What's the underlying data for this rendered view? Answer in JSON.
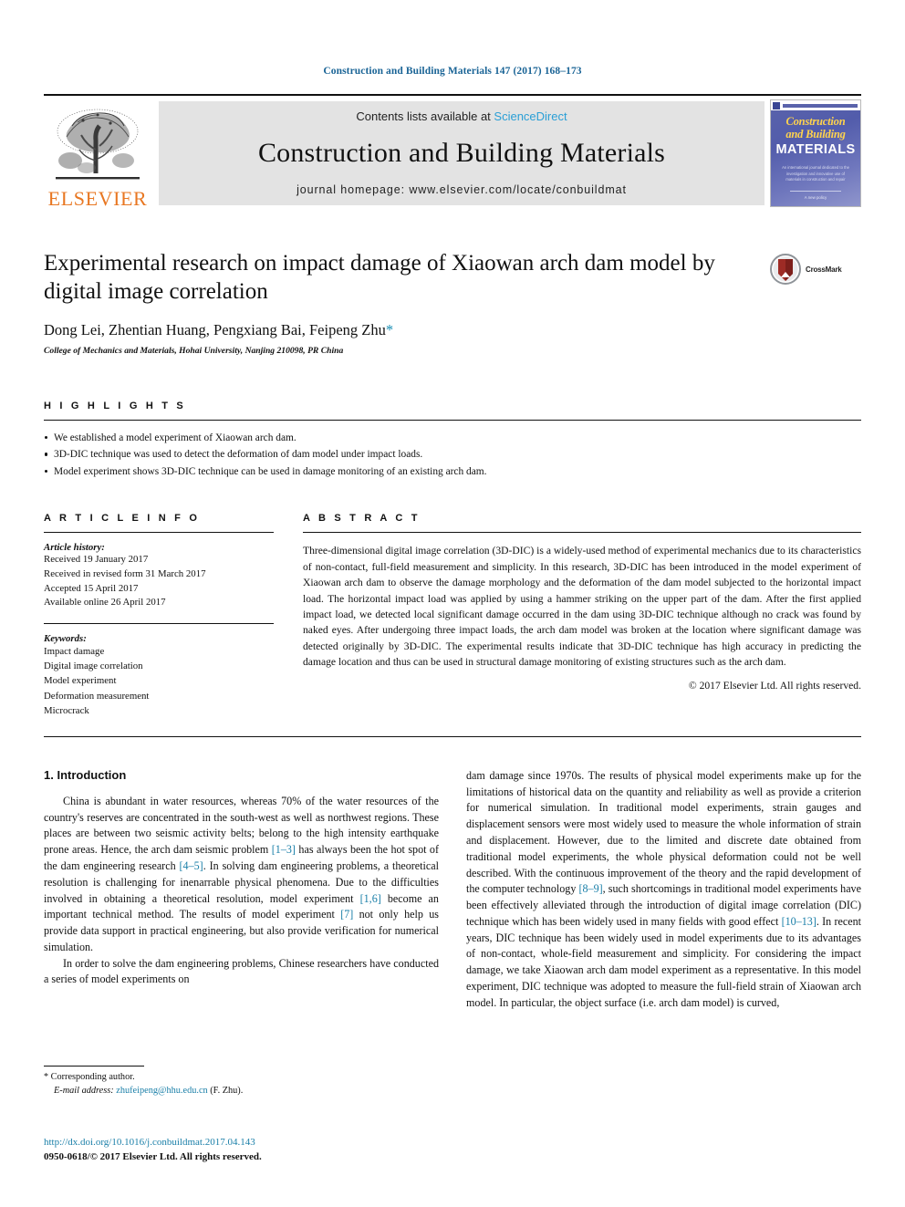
{
  "running_head": "Construction and Building Materials 147 (2017) 168–173",
  "masthead": {
    "publisher_logo_text": "ELSEVIER",
    "contents_prefix": "Contents lists available at ",
    "contents_link": "ScienceDirect",
    "journal_title": "Construction and Building Materials",
    "homepage": "journal homepage: www.elsevier.com/locate/conbuildmat",
    "cover": {
      "line1": "Construction",
      "line2": "and Building",
      "line3": "MATERIALS",
      "subtitle": "An international journal dedicated to the investigation and innovative use of materials in construction and repair",
      "footer": "A new policy"
    }
  },
  "article": {
    "title": "Experimental research on impact damage of Xiaowan arch dam model by digital image correlation",
    "authors": "Dong Lei, Zhentian Huang, Pengxiang Bai, Feipeng Zhu",
    "corresponding_marker": "*",
    "affiliation": "College of Mechanics and Materials, Hohai University, Nanjing 210098, PR China",
    "crossmark_label": "CrossMark"
  },
  "highlights": {
    "heading": "H I G H L I G H T S",
    "items": [
      "We established a model experiment of Xiaowan arch dam.",
      "3D-DIC technique was used to detect the deformation of dam model under impact loads.",
      "Model experiment shows 3D-DIC technique can be used in damage monitoring of an existing arch dam."
    ]
  },
  "article_info": {
    "heading": "A R T I C L E   I N F O",
    "history_label": "Article history:",
    "history": [
      "Received 19 January 2017",
      "Received in revised form 31 March 2017",
      "Accepted 15 April 2017",
      "Available online 26 April 2017"
    ],
    "keywords_label": "Keywords:",
    "keywords": [
      "Impact damage",
      "Digital image correlation",
      "Model experiment",
      "Deformation measurement",
      "Microcrack"
    ]
  },
  "abstract": {
    "heading": "A B S T R A C T",
    "text": "Three-dimensional digital image correlation (3D-DIC) is a widely-used method of experimental mechanics due to its characteristics of non-contact, full-field measurement and simplicity. In this research, 3D-DIC has been introduced in the model experiment of Xiaowan arch dam to observe the damage morphology and the deformation of the dam model subjected to the horizontal impact load. The horizontal impact load was applied by using a hammer striking on the upper part of the dam. After the first applied impact load, we detected local significant damage occurred in the dam using 3D-DIC technique although no crack was found by naked eyes. After undergoing three impact loads, the arch dam model was broken at the location where significant damage was detected originally by 3D-DIC. The experimental results indicate that 3D-DIC technique has high accuracy in predicting the damage location and thus can be used in structural damage monitoring of existing structures such as the arch dam.",
    "copyright": "© 2017 Elsevier Ltd. All rights reserved."
  },
  "introduction": {
    "section_title": "1. Introduction",
    "left_para1_a": "China is abundant in water resources, whereas 70% of the water resources of the country's reserves are concentrated in the south-west as well as northwest regions. These places are between two seismic activity belts; belong to the high intensity earthquake prone areas. Hence, the arch dam seismic problem ",
    "left_cite1": "[1–3]",
    "left_para1_b": " has always been the hot spot of the dam engineering research ",
    "left_cite2": "[4–5]",
    "left_para1_c": ". In solving dam engineering problems, a theoretical resolution is challenging for inenarrable physical phenomena. Due to the difficulties involved in obtaining a theoretical resolution, model experiment ",
    "left_cite3": "[1,6]",
    "left_para1_d": " become an important technical method. The results of model experiment ",
    "left_cite4": "[7]",
    "left_para1_e": " not only help us provide data support in practical engineering, but also provide verification for numerical simulation.",
    "left_para2": "In order to solve the dam engineering problems, Chinese researchers have conducted a series of model experiments on",
    "right_para_a": "dam damage since 1970s. The results of physical model experiments make up for the limitations of historical data on the quantity and reliability as well as provide a criterion for numerical simulation. In traditional model experiments, strain gauges and displacement sensors were most widely used to measure the whole information of strain and displacement. However, due to the limited and discrete date obtained from traditional model experiments, the whole physical deformation could not be well described. With the continuous improvement of the theory and the rapid development of the computer technology ",
    "right_cite1": "[8–9]",
    "right_para_b": ", such shortcomings in traditional model experiments have been effectively alleviated through the introduction of digital image correlation (DIC) technique which has been widely used in many fields with good effect ",
    "right_cite2": "[10–13]",
    "right_para_c": ". In recent years, DIC technique has been widely used in model experiments due to its advantages of non-contact, whole-field measurement and simplicity. For considering the impact damage, we take Xiaowan arch dam model experiment as a representative. In this model experiment, DIC technique was adopted to measure the full-field strain of Xiaowan arch model. In particular, the object surface (i.e. arch dam model) is curved,"
  },
  "footnote": {
    "star": "*",
    "corresponding": "Corresponding author.",
    "email_label": "E-mail address:",
    "email": "zhufeipeng@hhu.edu.cn",
    "email_suffix": " (F. Zhu).",
    "doi": "http://dx.doi.org/10.1016/j.conbuildmat.2017.04.143",
    "issn": "0950-0618/© 2017 Elsevier Ltd. All rights reserved."
  },
  "colors": {
    "link": "#1a7fa8",
    "running_head": "#1a6496",
    "elsevier_orange": "#E87722",
    "sciencedirect": "#2a9fd6",
    "cover_blue": "#5a63ab",
    "cover_yellow": "#ffd34d",
    "crossmark_red": "#9e2b25"
  }
}
